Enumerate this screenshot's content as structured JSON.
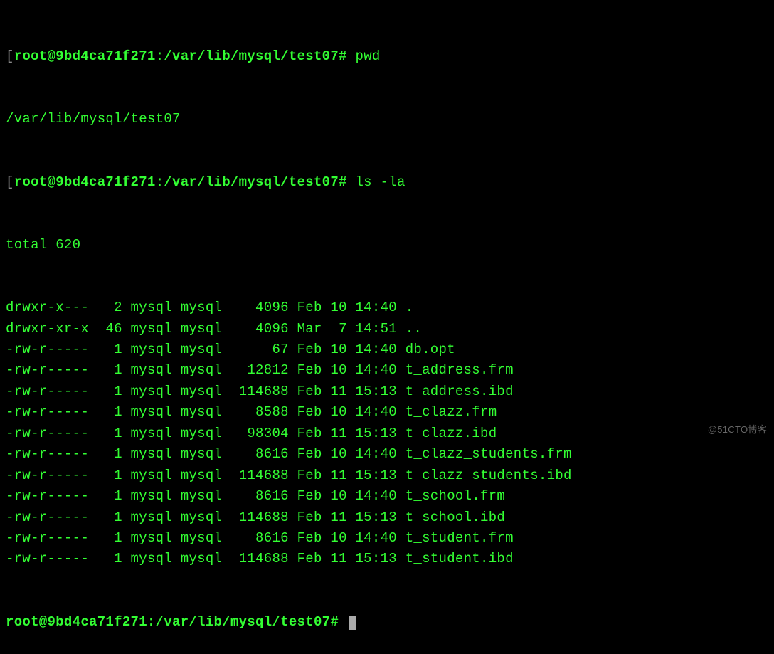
{
  "prompts": [
    {
      "bracket_l": "[",
      "text": "root@9bd4ca71f271:/var/lib/mysql/test07#",
      "bracket_r": "",
      "cmd": " pwd"
    },
    {
      "bracket_l": "[",
      "text": "root@9bd4ca71f271:/var/lib/mysql/test07#",
      "bracket_r": "",
      "cmd": " ls -la"
    },
    {
      "bracket_l": "",
      "text": "root@9bd4ca71f271:/var/lib/mysql/test07#",
      "bracket_r": "",
      "cmd": " "
    }
  ],
  "pwd_output": "/var/lib/mysql/test07",
  "total_line": "total 620",
  "ls_rows": [
    {
      "perm": "drwxr-x---",
      "links": "  2",
      "owner": "mysql",
      "group": "mysql",
      "size": "   4096",
      "month": "Feb",
      "day": "10",
      "time": "14:40",
      "name": "."
    },
    {
      "perm": "drwxr-xr-x",
      "links": " 46",
      "owner": "mysql",
      "group": "mysql",
      "size": "   4096",
      "month": "Mar",
      "day": " 7",
      "time": "14:51",
      "name": ".."
    },
    {
      "perm": "-rw-r-----",
      "links": "  1",
      "owner": "mysql",
      "group": "mysql",
      "size": "     67",
      "month": "Feb",
      "day": "10",
      "time": "14:40",
      "name": "db.opt"
    },
    {
      "perm": "-rw-r-----",
      "links": "  1",
      "owner": "mysql",
      "group": "mysql",
      "size": "  12812",
      "month": "Feb",
      "day": "10",
      "time": "14:40",
      "name": "t_address.frm"
    },
    {
      "perm": "-rw-r-----",
      "links": "  1",
      "owner": "mysql",
      "group": "mysql",
      "size": " 114688",
      "month": "Feb",
      "day": "11",
      "time": "15:13",
      "name": "t_address.ibd"
    },
    {
      "perm": "-rw-r-----",
      "links": "  1",
      "owner": "mysql",
      "group": "mysql",
      "size": "   8588",
      "month": "Feb",
      "day": "10",
      "time": "14:40",
      "name": "t_clazz.frm"
    },
    {
      "perm": "-rw-r-----",
      "links": "  1",
      "owner": "mysql",
      "group": "mysql",
      "size": "  98304",
      "month": "Feb",
      "day": "11",
      "time": "15:13",
      "name": "t_clazz.ibd"
    },
    {
      "perm": "-rw-r-----",
      "links": "  1",
      "owner": "mysql",
      "group": "mysql",
      "size": "   8616",
      "month": "Feb",
      "day": "10",
      "time": "14:40",
      "name": "t_clazz_students.frm"
    },
    {
      "perm": "-rw-r-----",
      "links": "  1",
      "owner": "mysql",
      "group": "mysql",
      "size": " 114688",
      "month": "Feb",
      "day": "11",
      "time": "15:13",
      "name": "t_clazz_students.ibd"
    },
    {
      "perm": "-rw-r-----",
      "links": "  1",
      "owner": "mysql",
      "group": "mysql",
      "size": "   8616",
      "month": "Feb",
      "day": "10",
      "time": "14:40",
      "name": "t_school.frm"
    },
    {
      "perm": "-rw-r-----",
      "links": "  1",
      "owner": "mysql",
      "group": "mysql",
      "size": " 114688",
      "month": "Feb",
      "day": "11",
      "time": "15:13",
      "name": "t_school.ibd"
    },
    {
      "perm": "-rw-r-----",
      "links": "  1",
      "owner": "mysql",
      "group": "mysql",
      "size": "   8616",
      "month": "Feb",
      "day": "10",
      "time": "14:40",
      "name": "t_student.frm"
    },
    {
      "perm": "-rw-r-----",
      "links": "  1",
      "owner": "mysql",
      "group": "mysql",
      "size": " 114688",
      "month": "Feb",
      "day": "11",
      "time": "15:13",
      "name": "t_student.ibd"
    }
  ],
  "watermark": "@51CTO博客"
}
